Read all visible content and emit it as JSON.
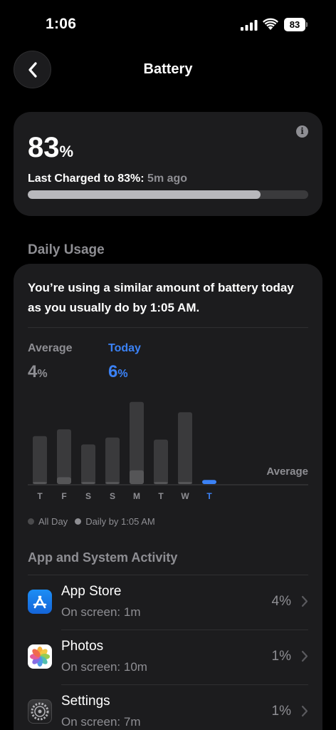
{
  "status": {
    "time": "1:06",
    "battery": "83"
  },
  "nav": {
    "title": "Battery"
  },
  "level": {
    "percent": "83",
    "unit": "%",
    "charged_label": "Last Charged to 83%:",
    "charged_ago": "5m ago",
    "fill_fraction": 0.83
  },
  "daily": {
    "section_title": "Daily Usage",
    "summary": "You’re using a similar amount of battery today as you usually do by 1:05 AM.",
    "average_label": "Average",
    "average_value": "4",
    "today_label": "Today",
    "today_value": "6",
    "unit": "%",
    "avg_line_label": "Average",
    "legend": {
      "all_day": "All Day",
      "daily_by": "Daily by 1:05 AM"
    }
  },
  "chart_data": {
    "type": "bar",
    "categories": [
      "T",
      "F",
      "S",
      "S",
      "M",
      "T",
      "W",
      "T"
    ],
    "series": [
      {
        "name": "All Day",
        "values": [
          70,
          80,
          58,
          68,
          120,
          65,
          105,
          0
        ]
      },
      {
        "name": "Daily by 1:05 AM",
        "values": [
          3,
          10,
          3,
          2,
          20,
          2,
          2,
          6
        ]
      }
    ],
    "highlight_index": 7,
    "ylim": [
      0,
      125
    ]
  },
  "activity": {
    "title": "App and System Activity",
    "apps": [
      {
        "name": "App Store",
        "screen": "On screen: 1m",
        "pct": "4%"
      },
      {
        "name": "Photos",
        "screen": "On screen: 10m",
        "pct": "1%"
      },
      {
        "name": "Settings",
        "screen": "On screen: 7m",
        "pct": "1%"
      }
    ]
  },
  "colors": {
    "accent": "#3b82f6",
    "card": "#1c1c1e",
    "secondary": "#8e8e93"
  }
}
